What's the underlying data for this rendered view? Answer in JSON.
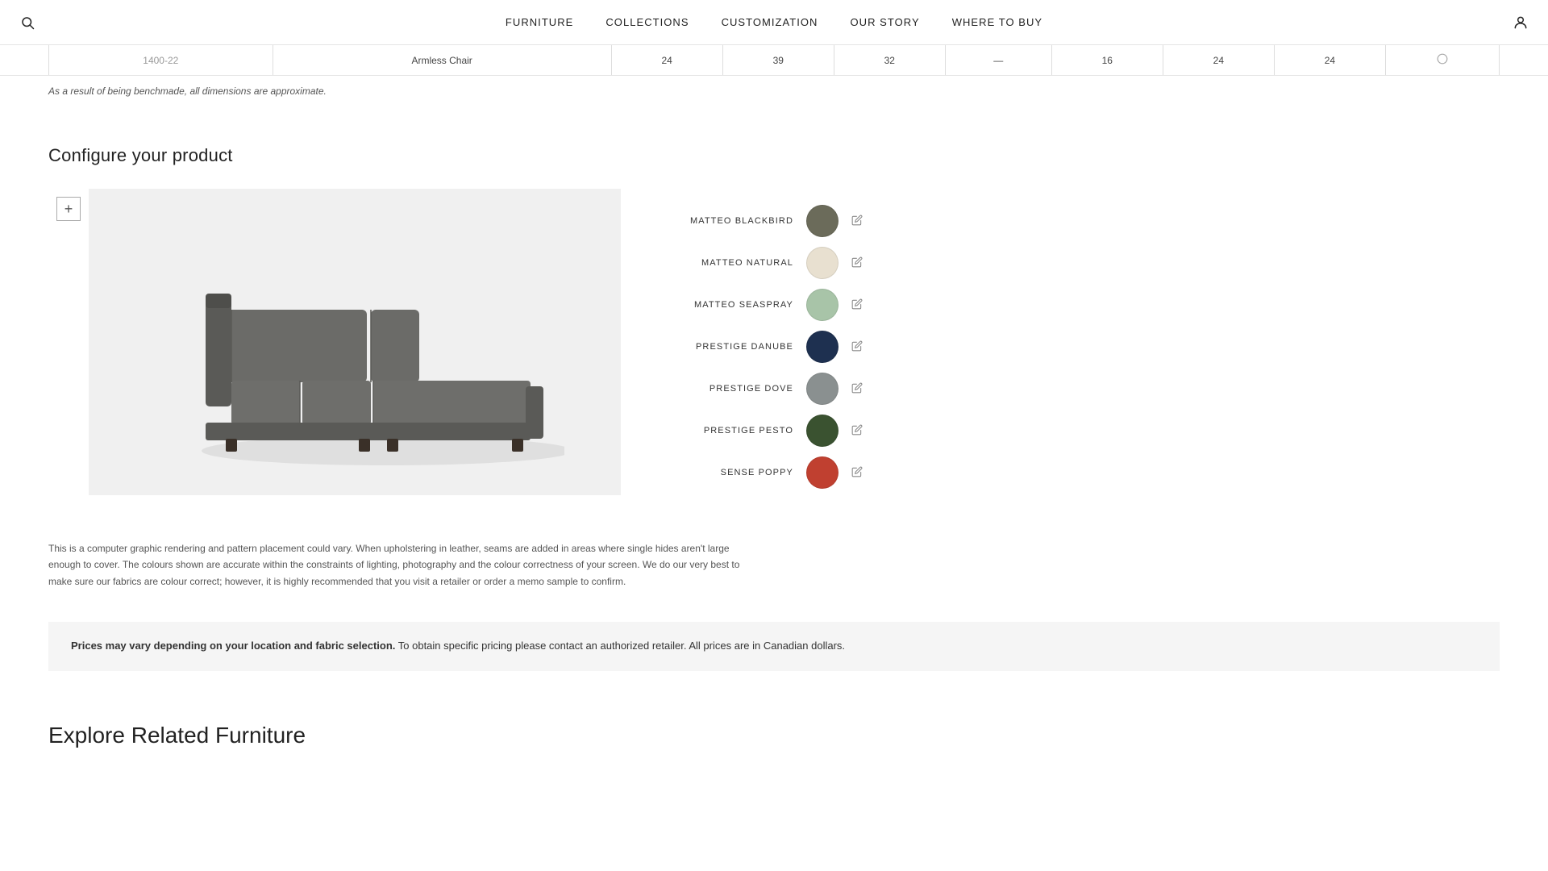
{
  "nav": {
    "links": [
      {
        "id": "furniture",
        "label": "FURNITURE"
      },
      {
        "id": "collections",
        "label": "COLLECTIONS"
      },
      {
        "id": "customization",
        "label": "CUSTOMIZATION"
      },
      {
        "id": "our-story",
        "label": "OUR STORY"
      },
      {
        "id": "where-to-buy",
        "label": "WHERE TO BUY"
      }
    ]
  },
  "table": {
    "row_num": "1400-22",
    "product_name": "Armless Chair",
    "cols": [
      "24",
      "39",
      "32",
      "—",
      "16",
      "24",
      "24",
      "✓"
    ]
  },
  "dimension_note": "As a result of being benchmade, all dimensions are approximate.",
  "configure": {
    "title": "Configure your product",
    "add_button": "+"
  },
  "swatches": [
    {
      "id": "matteo-blackbird",
      "name": "MATTEO BLACKBIRD",
      "color": "#6b6b5a"
    },
    {
      "id": "matteo-natural",
      "name": "MATTEO NATURAL",
      "color": "#e8e0d0"
    },
    {
      "id": "matteo-seaspray",
      "name": "MATTEO SEASPRAY",
      "color": "#a8c4a8"
    },
    {
      "id": "prestige-danube",
      "name": "PRESTIGE DANUBE",
      "color": "#1e3050"
    },
    {
      "id": "prestige-dove",
      "name": "PRESTIGE DOVE",
      "color": "#8a9090"
    },
    {
      "id": "prestige-pesto",
      "name": "PRESTIGE PESTO",
      "color": "#3a5230"
    },
    {
      "id": "sense-poppy",
      "name": "SENSE POPPY",
      "color": "#c04030"
    }
  ],
  "disclaimer": "This is a computer graphic rendering and pattern placement could vary. When upholstering in leather, seams are added in areas where single hides aren't large enough to cover. The colours shown are accurate within the constraints of lighting, photography and the colour correctness of your screen. We do our very best to make sure our fabrics are colour correct; however, it is highly recommended that you visit a retailer or order a memo sample to confirm.",
  "price_notice": {
    "bold_part": "Prices may vary depending on your location and fabric selection.",
    "rest": " To obtain specific pricing please contact an authorized retailer. All prices are in Canadian dollars."
  },
  "related_heading": "Explore Related Furniture"
}
